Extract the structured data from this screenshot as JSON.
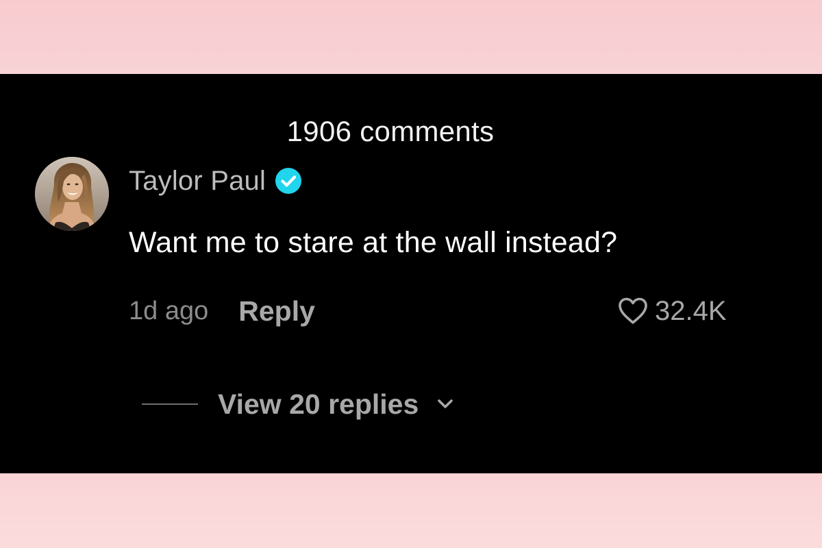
{
  "comments_header": {
    "count_text": "1906 comments"
  },
  "comment": {
    "author": "Taylor Paul",
    "verified": true,
    "text": "Want me to stare at the wall instead?",
    "timestamp": "1d ago",
    "reply_label": "Reply",
    "likes": "32.4K",
    "view_replies_label": "View 20 replies"
  },
  "icons": {
    "verified": "verified-check-icon",
    "like": "heart-outline-icon",
    "expand": "chevron-down-icon",
    "avatar": "profile-photo"
  },
  "colors": {
    "background_band": "#f9cfd3",
    "panel": "#000000",
    "verified_badge": "#20d5ec",
    "primary_text": "#ffffff",
    "secondary_text": "#a8a8a8"
  }
}
